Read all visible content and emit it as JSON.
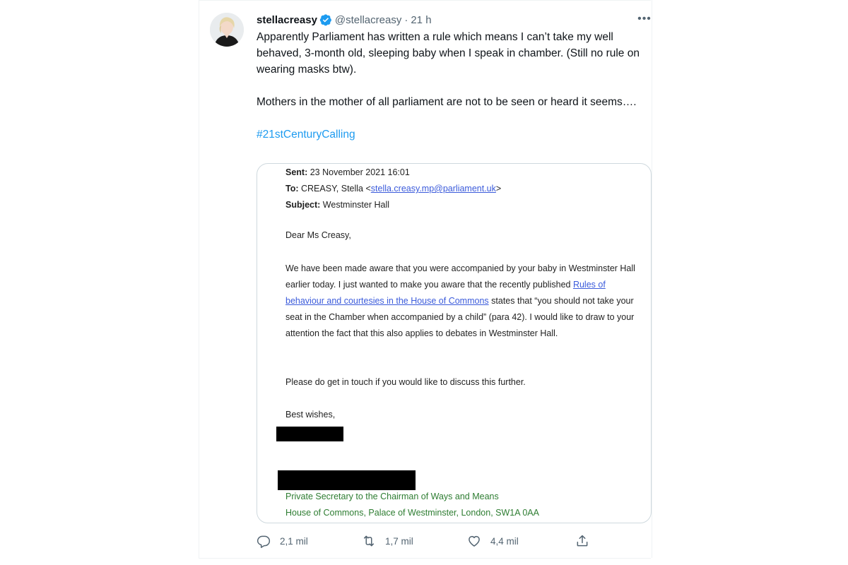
{
  "tweet": {
    "display_name": "stellacreasy",
    "handle": "@stellacreasy",
    "separator": "·",
    "time": "21 h",
    "more": "•••",
    "text_line1": "Apparently Parliament has written a rule which means I can’t take my well behaved, 3-month old, sleeping baby when I speak in chamber. (Still no rule on wearing masks btw).",
    "text_line2": "Mothers in the mother of all parliament are not to be seen or heard it seems….",
    "hashtag": "#21stCenturyCalling"
  },
  "email": {
    "sent_label": "Sent:",
    "sent_value": "23 November 2021 16:01",
    "to_label": "To:",
    "to_value": "CREASY, Stella <",
    "to_link": "stella.creasy.mp@parliament.uk",
    "to_close": ">",
    "subject_label": "Subject:",
    "subject_value": "Westminster Hall",
    "greeting": "Dear Ms Creasy,",
    "body_part1": "We have been made aware that you were accompanied by your baby in Westminster Hall earlier today. I just wanted to make you aware that the recently published ",
    "body_link": "Rules of behaviour and courtesies in the House of Commons",
    "body_part2": " states that “you should not take your seat in the Chamber when accompanied by a child” (para 42). I would like to draw to your attention the fact that this also applies to debates in Westminster Hall.",
    "closing_line": "Please do get in touch if you would like to discuss this further.",
    "sign_off": "Best wishes,",
    "signature_title": "Private Secretary to the Chairman of Ways and Means",
    "signature_address": "House of Commons, Palace of Westminster, London, SW1A 0AA"
  },
  "actions": {
    "reply_count": "2,1 mil",
    "retweet_count": "1,7 mil",
    "like_count": "4,4 mil"
  },
  "colors": {
    "accent": "#1d9bf0",
    "secondary_text": "#536471",
    "signature_green": "#2e7d32"
  },
  "icons": [
    "verified-badge-icon",
    "more-icon",
    "reply-icon",
    "retweet-icon",
    "like-icon",
    "share-icon"
  ]
}
